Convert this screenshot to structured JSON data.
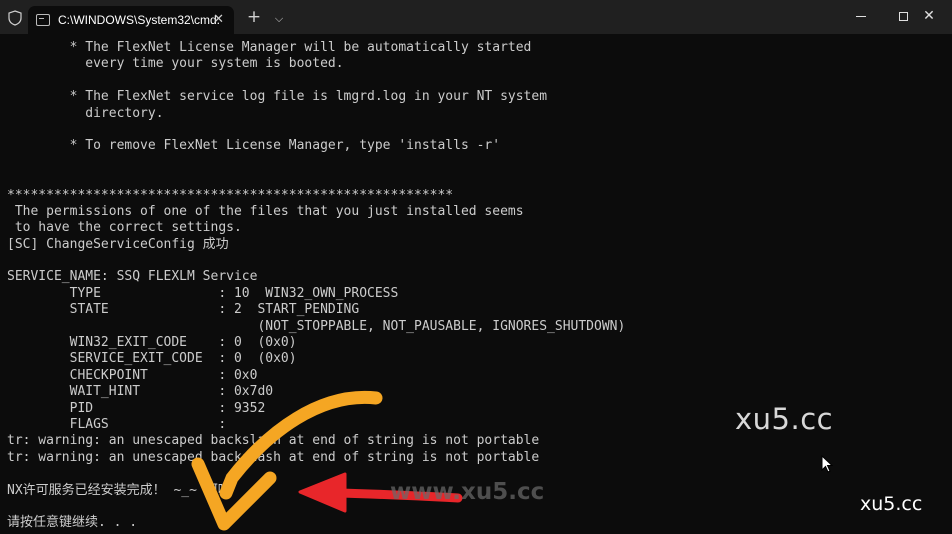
{
  "titlebar": {
    "tab_title": "C:\\WINDOWS\\System32\\cmd.",
    "tab_close": "✕",
    "new_tab": "+",
    "dropdown": "⌵",
    "close_glyph": "✕",
    "icons": [
      "shield-icon",
      "cmd-icon",
      "close-icon",
      "plus-icon",
      "chevron-down-icon",
      "minimize-icon",
      "maximize-icon",
      "close-window-icon"
    ]
  },
  "console": {
    "lines": [
      "        * The FlexNet License Manager will be automatically started",
      "          every time your system is booted.",
      "",
      "        * The FlexNet service log file is lmgrd.log in your NT system",
      "          directory.",
      "",
      "        * To remove FlexNet License Manager, type 'installs -r'",
      "",
      "",
      "*********************************************************",
      " The permissions of one of the files that you just installed seems",
      " to have the correct settings.",
      "[SC] ChangeServiceConfig 成功",
      "",
      "SERVICE_NAME: SSQ FLEXLM Service",
      "        TYPE               : 10  WIN32_OWN_PROCESS",
      "        STATE              : 2  START_PENDING",
      "                                (NOT_STOPPABLE, NOT_PAUSABLE, IGNORES_SHUTDOWN)",
      "        WIN32_EXIT_CODE    : 0  (0x0)",
      "        SERVICE_EXIT_CODE  : 0  (0x0)",
      "        CHECKPOINT         : 0x0",
      "        WAIT_HINT          : 0x7d0",
      "        PID                : 9352",
      "        FLAGS              :",
      "tr: warning: an unescaped backslash at end of string is not portable",
      "tr: warning: an unescaped backslash at end of string is not portable",
      "",
      "NX许可服务已经安装完成！ ~_~ 呵呵",
      "",
      "请按任意键继续. . ."
    ]
  },
  "watermarks": {
    "large": "xu5.cc",
    "center": "www.xu5.cc",
    "small": "xu5.cc"
  },
  "colors": {
    "console_bg": "#0c0c0c",
    "console_text": "#cccccc",
    "titlebar_bg": "#202020",
    "arrow_orange": "#f5a623",
    "arrow_red": "#e8262a"
  }
}
